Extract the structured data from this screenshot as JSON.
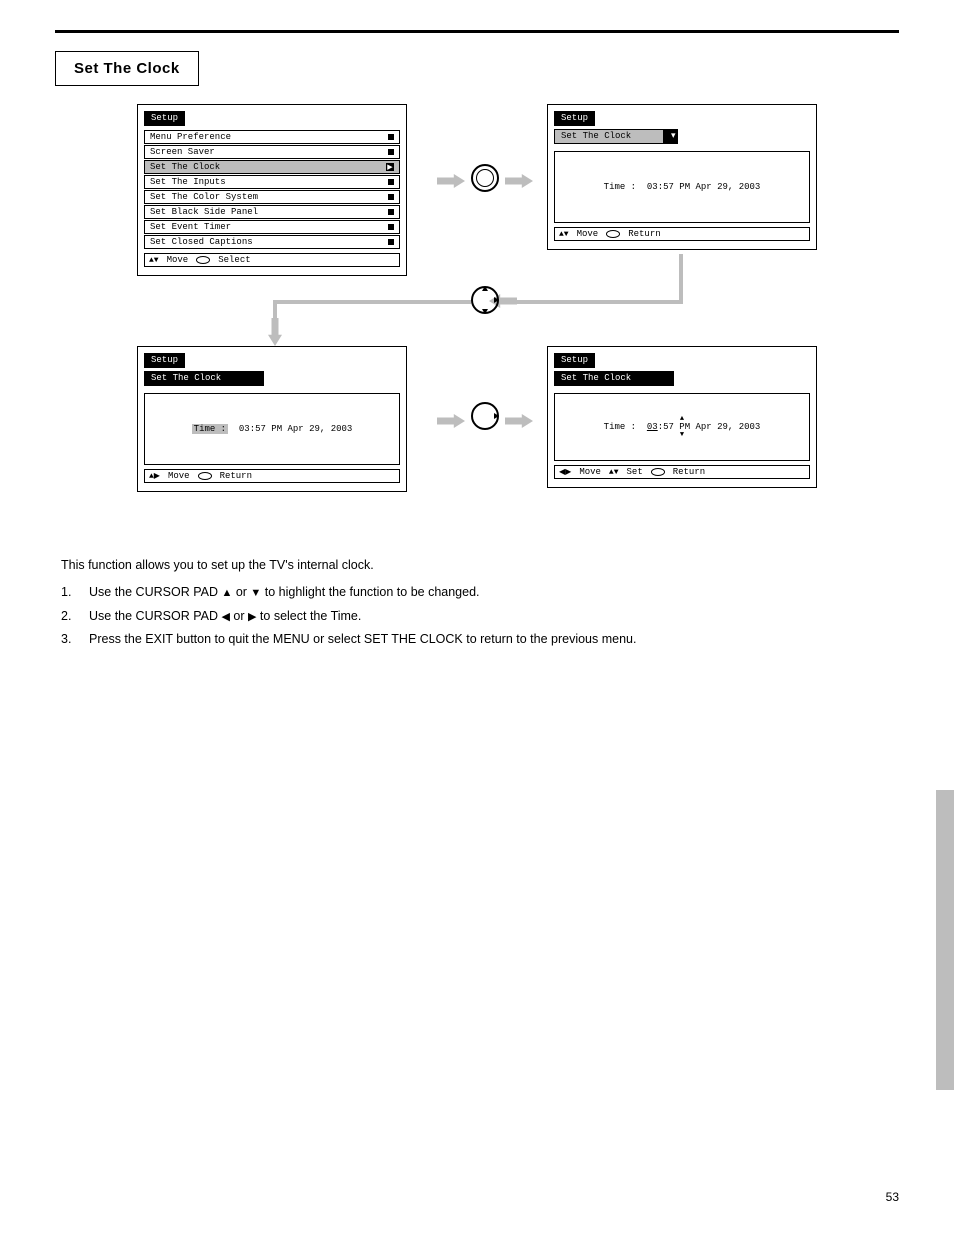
{
  "page": {
    "title_box": "Set The Clock",
    "footer": "53"
  },
  "screen1": {
    "tab": "Setup",
    "items": [
      "Menu Preference",
      "Screen Saver",
      "Set The Clock",
      "Set The Inputs",
      "Set The Color System",
      "Set Black Side Panel",
      "Set Event Timer",
      "Set Closed Captions"
    ],
    "help_move": "Move",
    "help_sel": "Select"
  },
  "screen2": {
    "tab": "Setup",
    "sub": "Set The Clock",
    "time_prefix": "Time :",
    "time_value": "03:57 PM Apr 29, 2003",
    "help_move": "Move",
    "help_ret": "Return"
  },
  "screen3": {
    "tab": "Setup",
    "sub": "Set The Clock",
    "time_prefix": "Time :",
    "time_value": "03:57 PM Apr 29, 2003",
    "help_move": "Move",
    "help_ret": "Return"
  },
  "screen4": {
    "tab": "Setup",
    "sub": "Set The Clock",
    "time_prefix": "Time :",
    "time_hour": "03",
    "time_rest": ":57 PM Apr 29, 2003",
    "help_move": "Move",
    "help_set": "Set",
    "help_ret": "Return"
  },
  "instructions": {
    "lead": "This function allows you to set up the TV's internal clock.",
    "step1_n": "1.",
    "step1_a": "Use the CURSOR PAD ",
    "step1_b": " or ",
    "step1_c": " to highlight the function to be changed.",
    "step2_n": "2.",
    "step2_a": "Use the CURSOR PAD ",
    "step2_b": " or ",
    "step2_c": " to select the Time.",
    "step3_n": "3.",
    "step3_a": "Press the EXIT button to quit the MENU or select SET THE CLOCK to\nreturn to the previous menu."
  }
}
